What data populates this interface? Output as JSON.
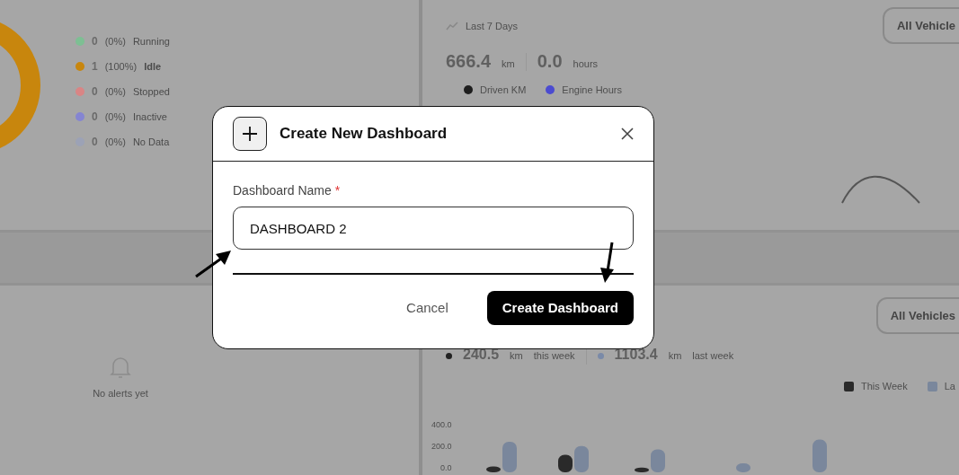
{
  "background": {
    "status_legend": [
      {
        "value": "0",
        "percent": "(0%)",
        "label": "Running",
        "color": "#7dbf93"
      },
      {
        "value": "1",
        "percent": "(100%)",
        "label": "Idle",
        "color": "#c8860d"
      },
      {
        "value": "0",
        "percent": "(0%)",
        "label": "Stopped",
        "color": "#d98585"
      },
      {
        "value": "0",
        "percent": "(0%)",
        "label": "Inactive",
        "color": "#8585d2"
      },
      {
        "value": "0",
        "percent": "(0%)",
        "label": "No Data",
        "color": "#9ca2b6"
      }
    ],
    "distance_panel": {
      "range": "Last 7 Days",
      "filter": "All Vehicle",
      "stats": [
        {
          "value": "666.4",
          "unit": "km"
        },
        {
          "value": "0.0",
          "unit": "hours"
        }
      ],
      "legend": [
        {
          "label": "Driven KM",
          "color": "#1e1e1e"
        },
        {
          "label": "Engine Hours",
          "color": "#4b4bd0"
        }
      ]
    },
    "alerts_panel": {
      "empty_text": "No alerts yet"
    },
    "weekly_panel": {
      "filter": "All Vehicles",
      "stats": [
        {
          "value": "240.5",
          "unit": "km",
          "period": "this week",
          "color": "#222222"
        },
        {
          "value": "1103.4",
          "unit": "km",
          "period": "last week",
          "color": "#7a8aa8"
        }
      ],
      "legend": [
        {
          "label": "This Week",
          "color": "#2a2a2a"
        },
        {
          "label": "La",
          "color": "#7a879c"
        }
      ],
      "axis_labels": [
        "400.0",
        "200.0",
        "0.0"
      ]
    }
  },
  "dialog": {
    "title": "Create New Dashboard",
    "field": {
      "label": "Dashboard Name",
      "required_mark": "*",
      "value": "DASHBOARD 2"
    },
    "buttons": [
      {
        "label": "Cancel",
        "kind": "secondary"
      },
      {
        "label": "Create Dashboard",
        "kind": "primary"
      }
    ]
  }
}
